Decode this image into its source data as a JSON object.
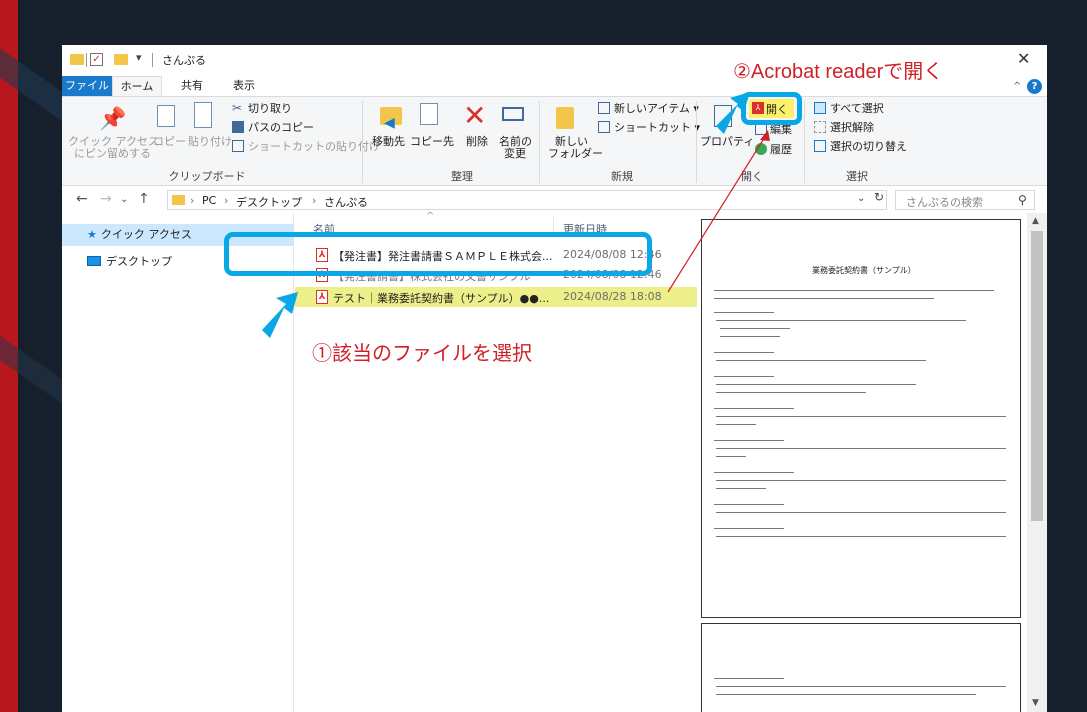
{
  "window": {
    "title": "さんぷる"
  },
  "tabs": [
    "ファイル",
    "ホーム",
    "共有",
    "表示"
  ],
  "ribbon": {
    "clipboard": {
      "pin_line1": "クイック アクセス",
      "pin_line2": "にピン留めする",
      "copy": "コピー",
      "paste": "貼り付け",
      "cut": "切り取り",
      "copy_path": "パスのコピー",
      "paste_shortcut": "ショートカットの貼り付け",
      "label": "クリップボード"
    },
    "organize": {
      "move_to": "移動先",
      "copy_to": "コピー先",
      "delete": "削除",
      "rename_line1": "名前の",
      "rename_line2": "変更",
      "label": "整理"
    },
    "new": {
      "new_folder_line1": "新しい",
      "new_folder_line2": "フォルダー",
      "new_item": "新しいアイテム",
      "easy_access": "ショートカット",
      "label": "新規"
    },
    "open": {
      "properties": "プロパティ",
      "open": "開く",
      "edit": "編集",
      "history": "履歴",
      "label": "開く"
    },
    "select": {
      "select_all": "すべて選択",
      "select_none": "選択解除",
      "invert": "選択の切り替え",
      "label": "選択"
    }
  },
  "address": {
    "path": [
      "PC",
      "デスクトップ",
      "さんぷる"
    ],
    "search_placeholder": "さんぷるの検索"
  },
  "nav_pane": {
    "quick_access": "クイック アクセス",
    "desktop": "デスクトップ"
  },
  "file_list": {
    "col_name": "名前",
    "col_date": "更新日時",
    "files": [
      {
        "name": "【発注書】発注書請書ＳＡＭＰＬＥ株式会...",
        "date": "2024/08/08 12:46"
      },
      {
        "name": "【発注書請書】株式会社の文書サンプル",
        "date": "2024/08/08 12:46"
      },
      {
        "name": "テスト｜業務委託契約書（サンプル）●●...",
        "date": "2024/08/28 18:08"
      }
    ]
  },
  "preview": {
    "doc_title": "業務委託契約書（サンプル）"
  },
  "annotations": {
    "step1": "①該当のファイルを選択",
    "step2": "②Acrobat readerで開く"
  },
  "colors": {
    "accent": "#0aa7e6",
    "annotation_red": "#d01f27",
    "highlight": "#ecef8a",
    "file_tab": "#1979ca"
  }
}
